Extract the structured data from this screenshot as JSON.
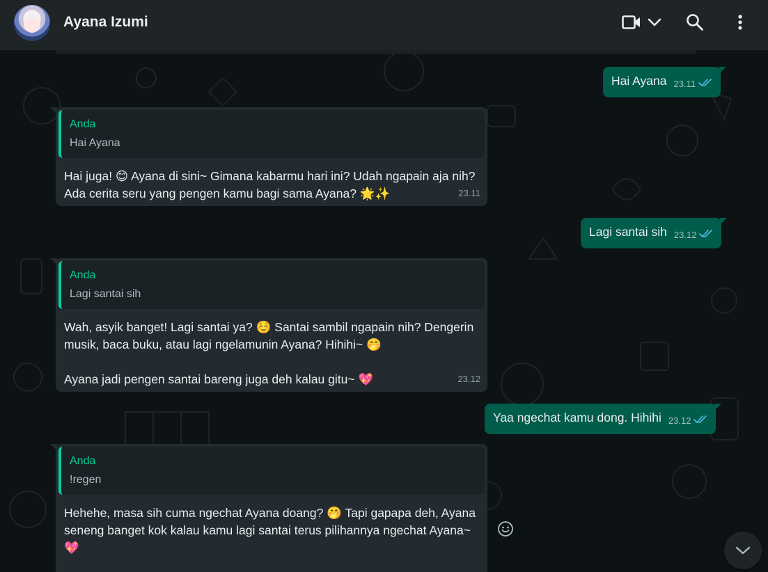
{
  "header": {
    "contact_name": "Ayana Izumi",
    "icons": [
      "video-call-icon",
      "chevron-down-icon",
      "search-icon",
      "menu-icon"
    ]
  },
  "messages": [
    {
      "direction": "out",
      "text": "Hai Ayana",
      "time": "23.11",
      "status": "read"
    },
    {
      "direction": "in",
      "quote_author": "Anda",
      "quote_text": "Hai Ayana",
      "text": "Hai juga! 😊 Ayana di sini~ Gimana kabarmu hari ini? Udah ngapain aja nih? Ada cerita seru yang pengen kamu bagi sama Ayana? 🌟✨",
      "time": "23.11"
    },
    {
      "direction": "out",
      "text": "Lagi santai sih",
      "time": "23.12",
      "status": "read"
    },
    {
      "direction": "in",
      "quote_author": "Anda",
      "quote_text": "Lagi santai sih",
      "text": "Wah, asyik banget! Lagi santai ya? ☺️ Santai sambil ngapain nih? Dengerin musik, baca buku, atau lagi ngelamunin Ayana? Hihihi~ 🤭\n\nAyana jadi pengen santai bareng juga deh kalau gitu~ 💖",
      "time": "23.12"
    },
    {
      "direction": "out",
      "text": "Yaa ngechat kamu dong. Hihihi",
      "time": "23.12",
      "status": "read"
    },
    {
      "direction": "in",
      "quote_author": "Anda",
      "quote_text": "!regen",
      "text": "Hehehe, masa sih cuma ngechat Ayana doang? 🤭 Tapi gapapa deh, Ayana seneng banget kok kalau kamu lagi santai terus pilihannya ngechat Ayana~ 💖",
      "time": ""
    }
  ],
  "colors": {
    "header_bg": "#1f2426",
    "outgoing_bubble": "#005c4b",
    "incoming_bubble": "#232b30",
    "quote_accent": "#06cf9c",
    "read_ticks": "#53bdeb"
  }
}
